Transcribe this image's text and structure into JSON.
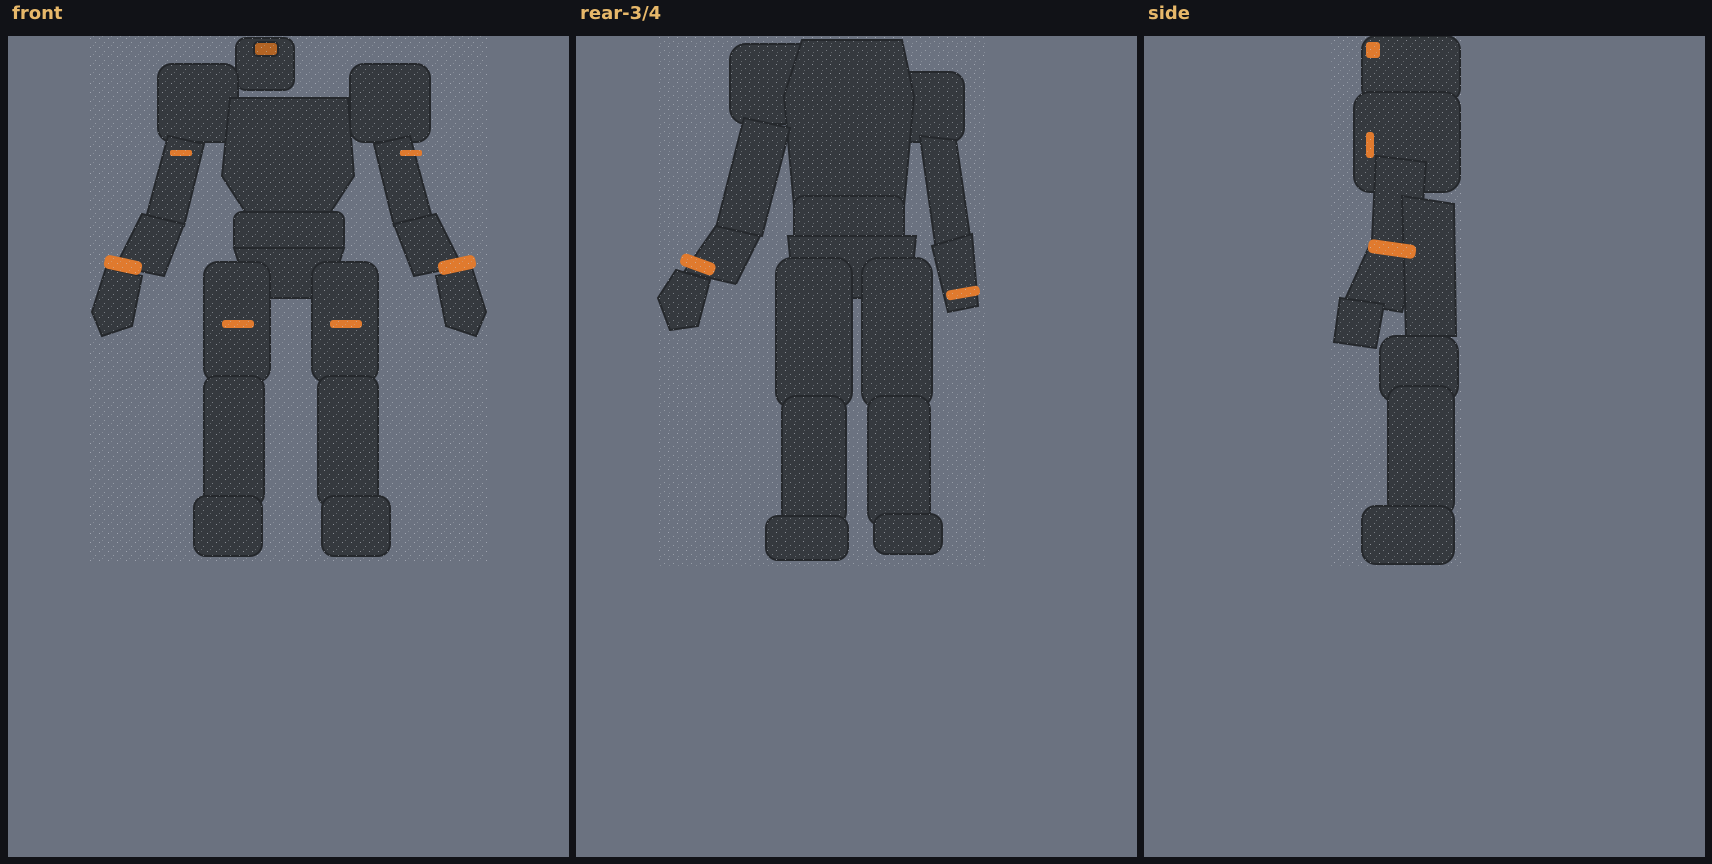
{
  "colors": {
    "background": "#111217",
    "viewport": "#6b7280",
    "label": "#e7b86a",
    "armor": "#353a3f",
    "accent": "#e07a2e"
  },
  "panels": [
    {
      "label": "front",
      "view": "front"
    },
    {
      "label": "rear-3/4",
      "view": "rear-three-quarter"
    },
    {
      "label": "side",
      "view": "side"
    }
  ]
}
